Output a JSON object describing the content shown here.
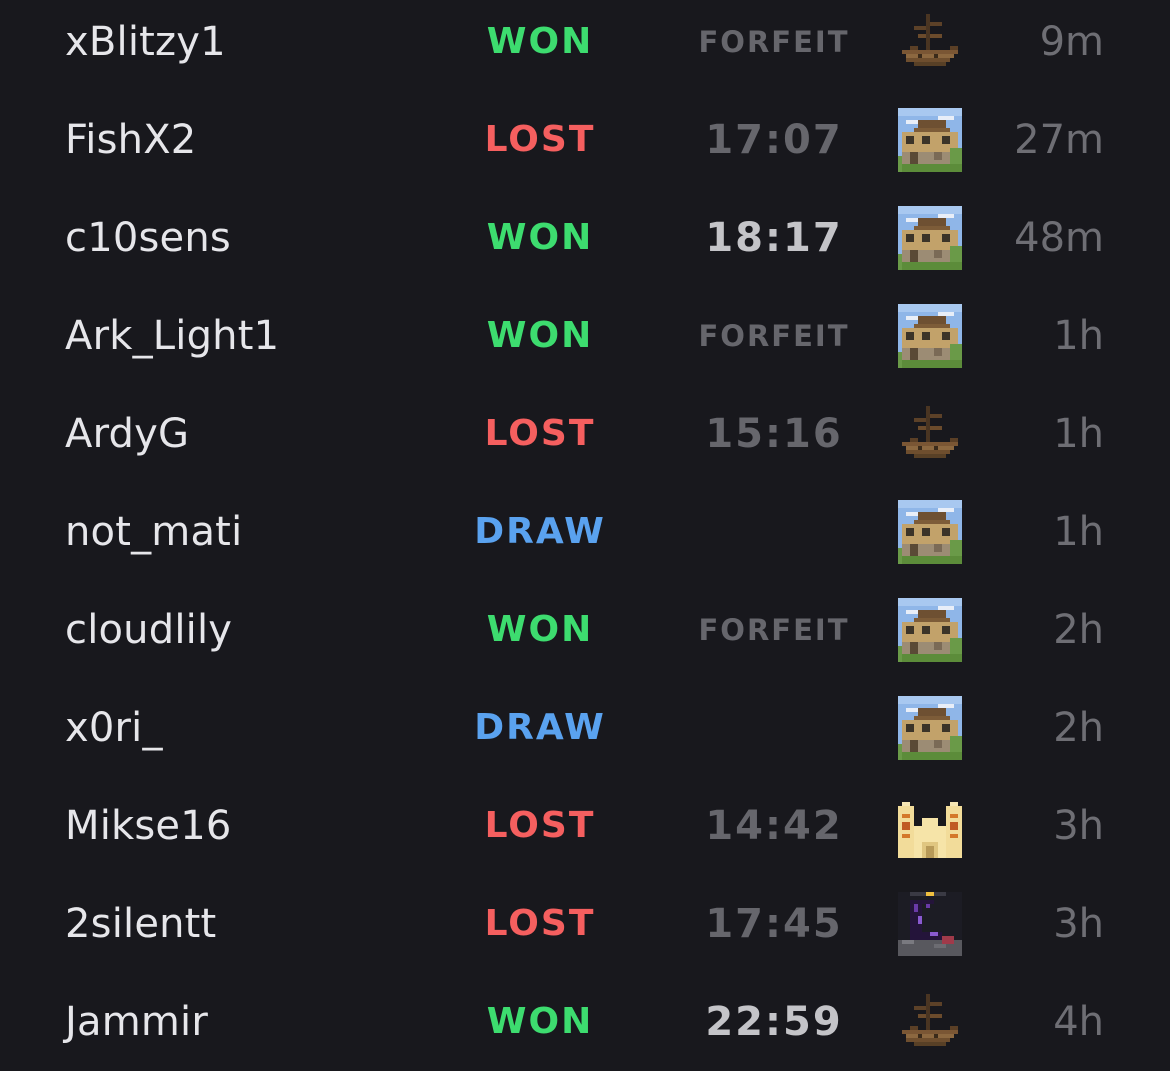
{
  "colors": {
    "background": "#18181d",
    "won": "#3ddc6f",
    "lost": "#f55f5f",
    "draw": "#5aa2ef",
    "player_text": "#e6e6ea",
    "muted_text": "#6e6e74",
    "highlight_time": "#c4c4c8"
  },
  "matches": [
    {
      "player": "xBlitzy1",
      "result": "WON",
      "time": "FORFEIT",
      "time_style": "forfeit",
      "map_icon": "shipwreck-icon",
      "ago": "9m"
    },
    {
      "player": "FishX2",
      "result": "LOST",
      "time": "17:07",
      "time_style": "dim",
      "map_icon": "village-icon",
      "ago": "27m"
    },
    {
      "player": "c10sens",
      "result": "WON",
      "time": "18:17",
      "time_style": "highlight",
      "map_icon": "village-icon",
      "ago": "48m"
    },
    {
      "player": "Ark_Light1",
      "result": "WON",
      "time": "FORFEIT",
      "time_style": "forfeit",
      "map_icon": "village-icon",
      "ago": "1h"
    },
    {
      "player": "ArdyG",
      "result": "LOST",
      "time": "15:16",
      "time_style": "dim",
      "map_icon": "shipwreck-icon",
      "ago": "1h"
    },
    {
      "player": "not_mati",
      "result": "DRAW",
      "time": "",
      "time_style": "none",
      "map_icon": "village-icon",
      "ago": "1h"
    },
    {
      "player": "cloudlily",
      "result": "WON",
      "time": "FORFEIT",
      "time_style": "forfeit",
      "map_icon": "village-icon",
      "ago": "2h"
    },
    {
      "player": "x0ri_",
      "result": "DRAW",
      "time": "",
      "time_style": "none",
      "map_icon": "village-icon",
      "ago": "2h"
    },
    {
      "player": "Mikse16",
      "result": "LOST",
      "time": "14:42",
      "time_style": "dim",
      "map_icon": "desert-temple-icon",
      "ago": "3h"
    },
    {
      "player": "2silentt",
      "result": "LOST",
      "time": "17:45",
      "time_style": "dim",
      "map_icon": "ruined-portal-icon",
      "ago": "3h"
    },
    {
      "player": "Jammir",
      "result": "WON",
      "time": "22:59",
      "time_style": "highlight",
      "map_icon": "shipwreck-icon",
      "ago": "4h"
    }
  ]
}
